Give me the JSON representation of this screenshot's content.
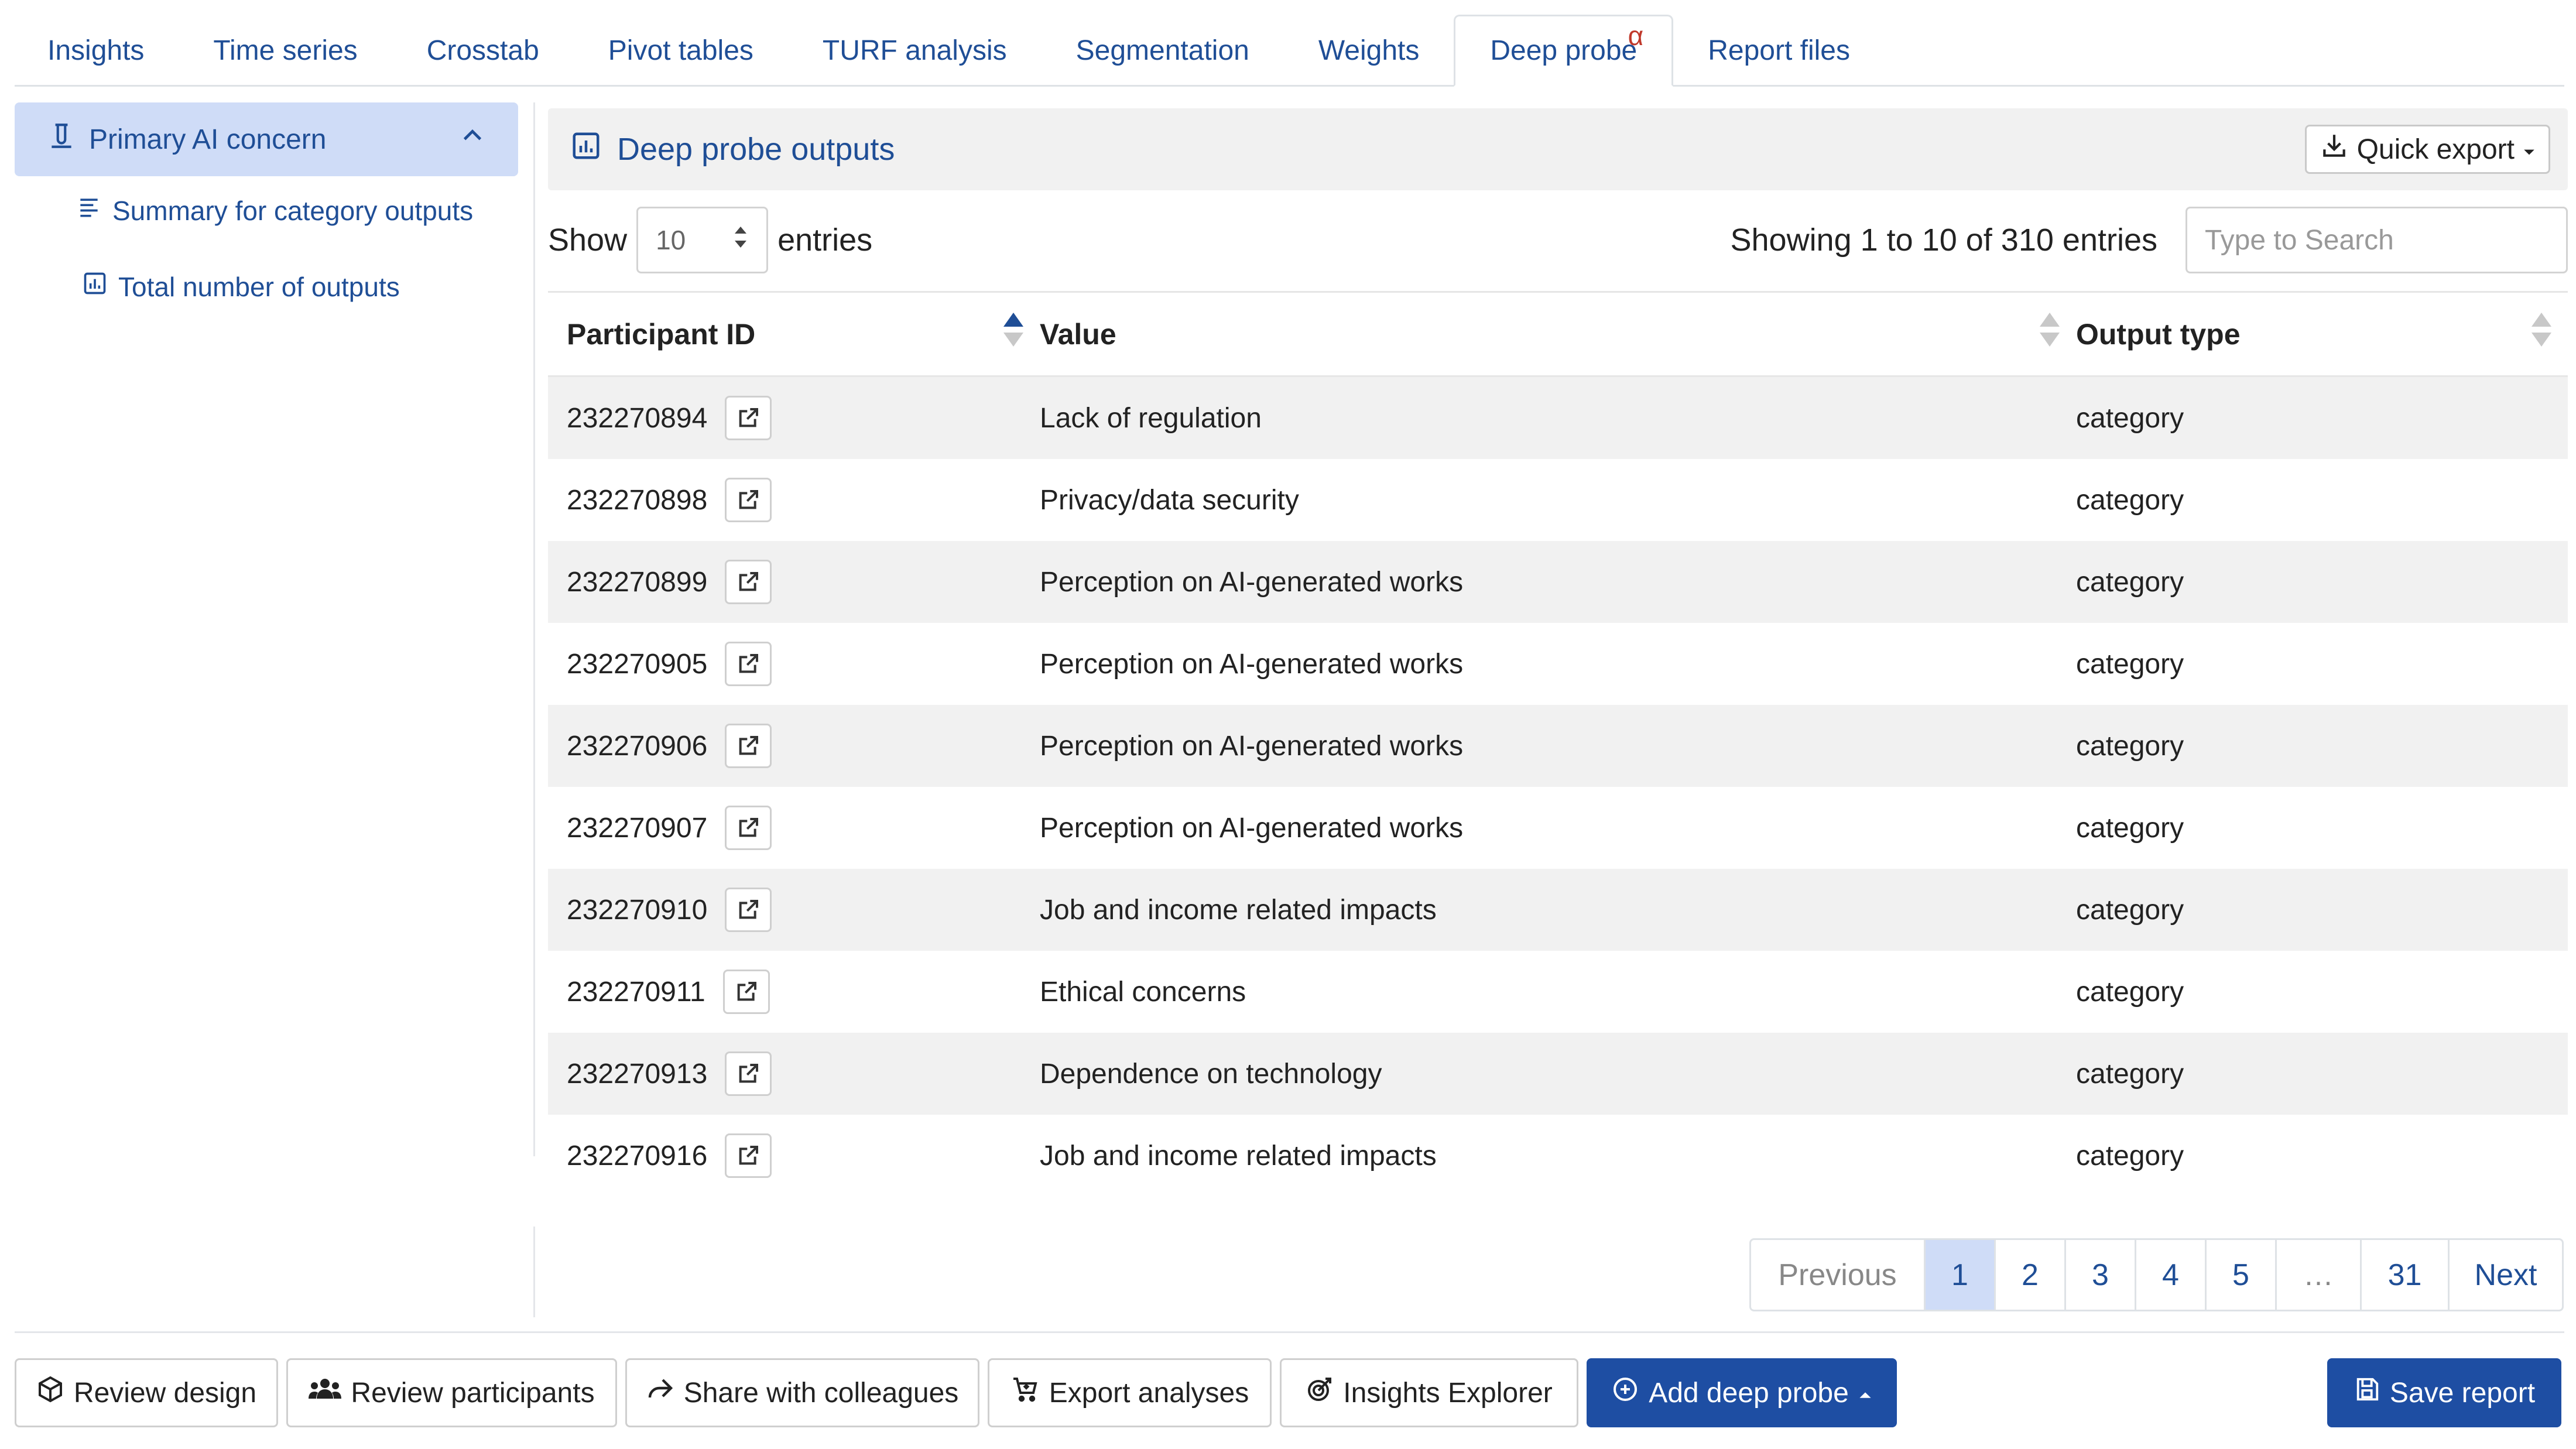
{
  "tabs": [
    {
      "label": "Insights"
    },
    {
      "label": "Time series"
    },
    {
      "label": "Crosstab"
    },
    {
      "label": "Pivot tables"
    },
    {
      "label": "TURF analysis"
    },
    {
      "label": "Segmentation"
    },
    {
      "label": "Weights"
    },
    {
      "label": "Deep probe",
      "badge": "α",
      "active": true
    },
    {
      "label": "Report files"
    }
  ],
  "sidebar": {
    "main": "Primary AI concern",
    "items": [
      {
        "label": "Summary for category outputs"
      },
      {
        "label": "Total number of outputs"
      }
    ]
  },
  "panel": {
    "title": "Deep probe outputs",
    "quick_export": "Quick export"
  },
  "controls": {
    "show_label": "Show",
    "entries_value": "10",
    "entries_label": "entries",
    "info": "Showing 1 to 10 of 310 entries",
    "search_placeholder": "Type to Search"
  },
  "table": {
    "headers": [
      "Participant ID",
      "Value",
      "Output type"
    ],
    "rows": [
      [
        "232270894",
        "Lack of regulation",
        "category"
      ],
      [
        "232270898",
        "Privacy/data security",
        "category"
      ],
      [
        "232270899",
        "Perception on AI-generated works",
        "category"
      ],
      [
        "232270905",
        "Perception on AI-generated works",
        "category"
      ],
      [
        "232270906",
        "Perception on AI-generated works",
        "category"
      ],
      [
        "232270907",
        "Perception on AI-generated works",
        "category"
      ],
      [
        "232270910",
        "Job and income related impacts",
        "category"
      ],
      [
        "232270911",
        "Ethical concerns",
        "category"
      ],
      [
        "232270913",
        "Dependence on technology",
        "category"
      ],
      [
        "232270916",
        "Job and income related impacts",
        "category"
      ]
    ]
  },
  "pagination": [
    "Previous",
    "1",
    "2",
    "3",
    "4",
    "5",
    "…",
    "31",
    "Next"
  ],
  "footer": {
    "review_design": "Review design",
    "review_participants": "Review participants",
    "share": "Share with colleagues",
    "export": "Export analyses",
    "insights_explorer": "Insights Explorer",
    "add_probe": "Add deep probe",
    "save": "Save report"
  },
  "colors": {
    "accent": "#1f4e96",
    "primary_button": "#1e4ea3",
    "active_bg": "#cfdcf7"
  }
}
